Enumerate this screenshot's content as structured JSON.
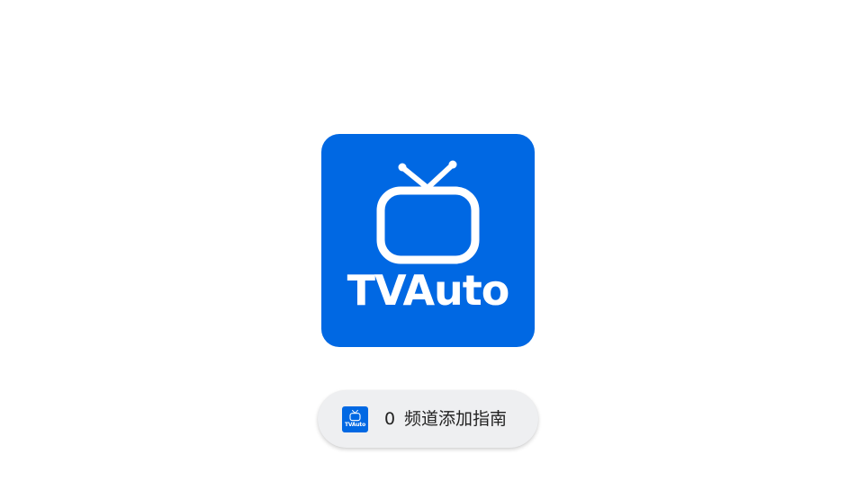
{
  "logo": {
    "text": "TVAuto",
    "icon": "tv-icon",
    "background": "#0068E3",
    "foreground": "#FFFFFF"
  },
  "guide_button": {
    "icon": "tvauto-app-icon",
    "icon_text": "TVAuto",
    "count": "0",
    "label": "频道添加指南",
    "background": "#EEEFF1",
    "text_color": "#222222"
  }
}
